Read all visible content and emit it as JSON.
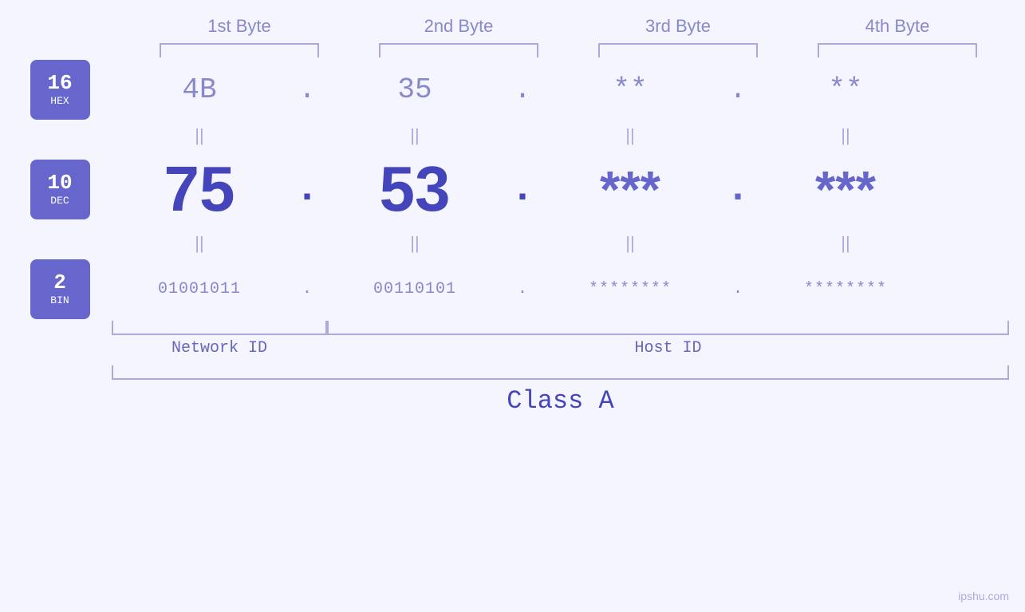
{
  "bytes": {
    "labels": [
      "1st Byte",
      "2nd Byte",
      "3rd Byte",
      "4th Byte"
    ]
  },
  "badges": [
    {
      "num": "16",
      "label": "HEX"
    },
    {
      "num": "10",
      "label": "DEC"
    },
    {
      "num": "2",
      "label": "BIN"
    }
  ],
  "hex": {
    "values": [
      "4B",
      "35",
      "**",
      "**"
    ],
    "dots": [
      ".",
      ".",
      ".",
      ""
    ]
  },
  "dec": {
    "values": [
      "75",
      "53",
      "***",
      "***"
    ],
    "dots": [
      ".",
      ".",
      ".",
      ""
    ]
  },
  "bin": {
    "values": [
      "01001011",
      "00110101",
      "********",
      "********"
    ],
    "dots": [
      ".",
      ".",
      ".",
      ""
    ]
  },
  "eq": "||",
  "labels": {
    "network_id": "Network ID",
    "host_id": "Host ID",
    "class": "Class A"
  },
  "watermark": "ipshu.com"
}
